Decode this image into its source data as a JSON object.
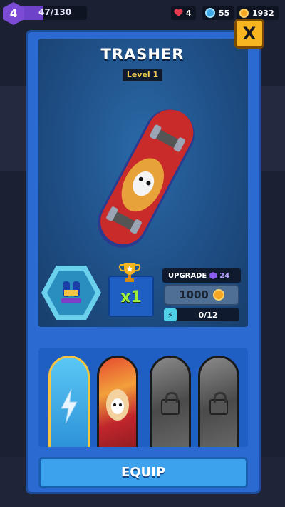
{
  "player": {
    "level": "4",
    "xp": "47/130",
    "xp_fraction": 0.36
  },
  "resources": [
    {
      "icon": "heart-icon",
      "value": "4"
    },
    {
      "icon": "key-icon",
      "value": "55"
    },
    {
      "icon": "coin-icon",
      "value": "1932"
    }
  ],
  "close_label": "X",
  "item": {
    "name": "TRASHER",
    "level": "Level 1"
  },
  "stats": {
    "multiplier": "x1"
  },
  "upgrade": {
    "label": "UPGRADE",
    "gem_cost": "24",
    "coin_cost": "1000",
    "shards": "0/12"
  },
  "cards": [
    {
      "state": "selected",
      "icon": "lightning-icon"
    },
    {
      "state": "skin-art"
    },
    {
      "state": "locked",
      "icon": "lock-icon"
    },
    {
      "state": "locked",
      "icon": "lock-icon"
    }
  ],
  "equip_label": "EQUIP"
}
